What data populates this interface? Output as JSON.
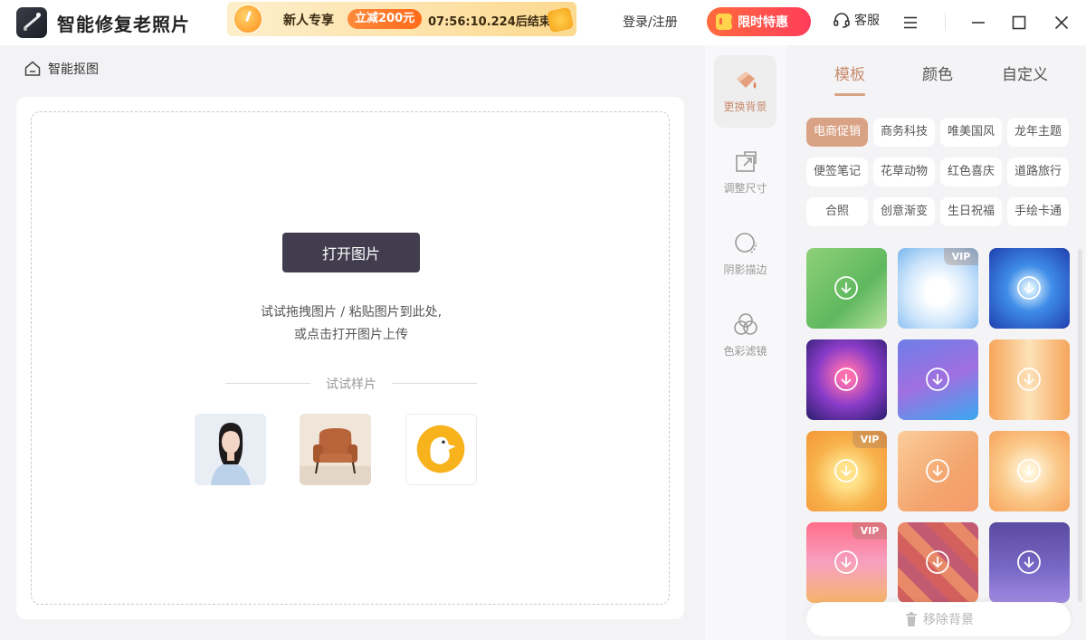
{
  "app": {
    "title": "智能修复老照片"
  },
  "promo": {
    "label": "新人专享",
    "discount": "立减200元",
    "countdown": "07:56:10.224后结束"
  },
  "header": {
    "login": "登录/注册",
    "vip": "限时特惠",
    "service": "客服"
  },
  "breadcrumb": {
    "label": "智能抠图"
  },
  "upload": {
    "open_button": "打开图片",
    "hint_line1": "试试拖拽图片 / 粘贴图片到此处,",
    "hint_line2": "或点击打开图片上传",
    "sample_label": "试试样片"
  },
  "tools": [
    {
      "label": "更换背景",
      "icon": "paint-bucket-icon",
      "active": true
    },
    {
      "label": "调整尺寸",
      "icon": "resize-icon",
      "active": false
    },
    {
      "label": "阴影描边",
      "icon": "shadow-outline-icon",
      "active": false
    },
    {
      "label": "色彩滤镜",
      "icon": "color-filter-icon",
      "active": false
    }
  ],
  "panel": {
    "tabs": [
      {
        "label": "模板",
        "active": true
      },
      {
        "label": "颜色",
        "active": false
      },
      {
        "label": "自定义",
        "active": false
      }
    ],
    "categories": [
      "电商促销",
      "商务科技",
      "唯美国风",
      "龙年主题",
      "便签笔记",
      "花草动物",
      "红色喜庆",
      "道路旅行",
      "合照",
      "创意渐变",
      "生日祝福",
      "手绘卡通"
    ],
    "active_category": "电商促销",
    "vip_badge": "VIP",
    "remove_bg": "移除背景"
  },
  "colors": {
    "accent": "#d9a285",
    "accent_text": "#c98b6e",
    "primary_button": "#423d4e",
    "vip_gradient_start": "#ff6b3d",
    "vip_gradient_end": "#ff3d5a"
  }
}
